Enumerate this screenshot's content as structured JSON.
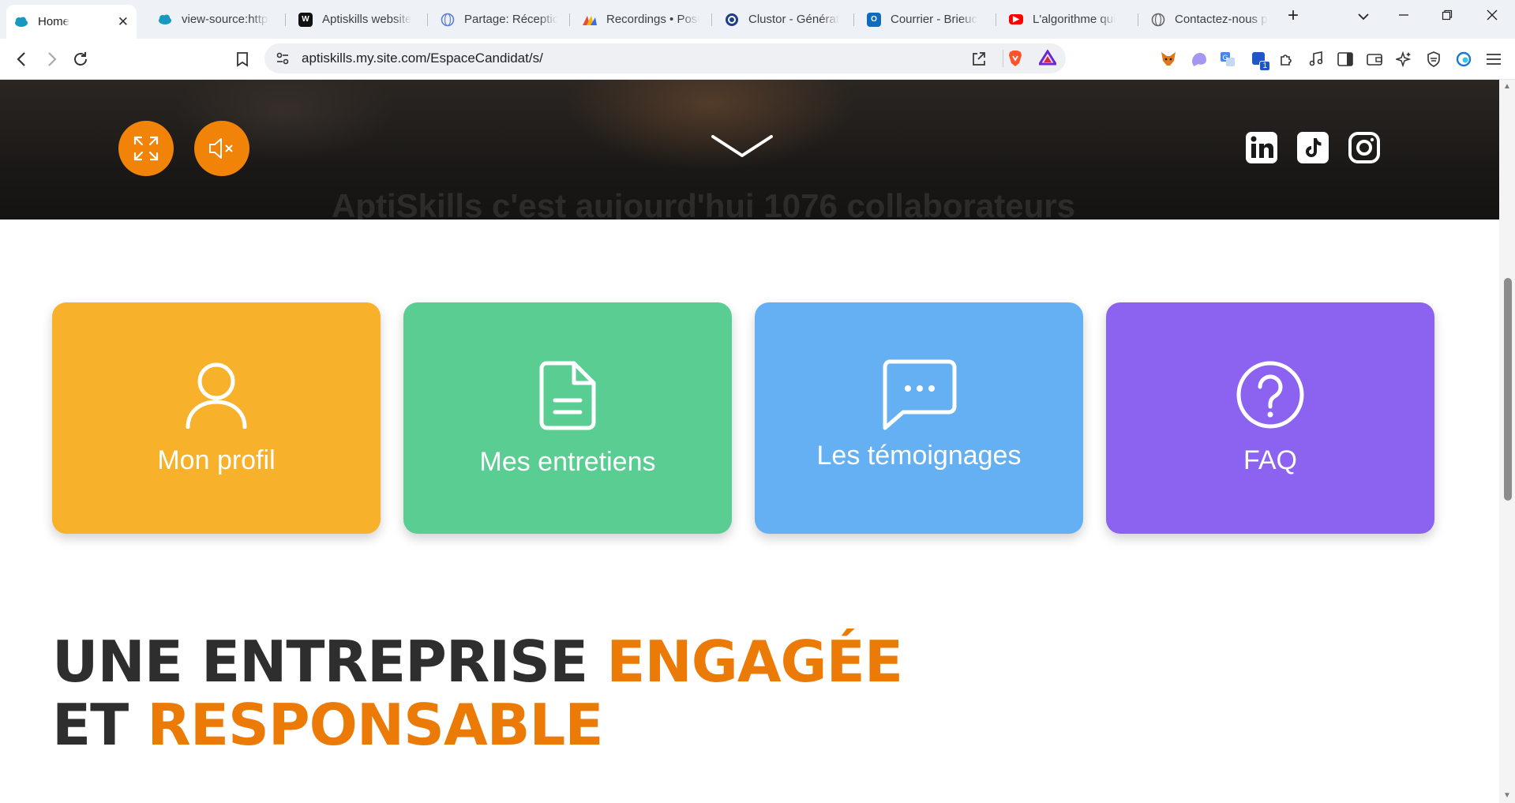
{
  "browser": {
    "tabs": [
      {
        "title": "Home",
        "active": true,
        "icon": "salesforce-cloud-icon"
      },
      {
        "title": "view-source:https",
        "icon": "salesforce-cloud-icon"
      },
      {
        "title": "Aptiskills website",
        "icon": "webflow-icon"
      },
      {
        "title": "Partage: Réception",
        "icon": "globe-icon"
      },
      {
        "title": "Recordings • Post",
        "icon": "recordings-icon"
      },
      {
        "title": "Clustor - Générat",
        "icon": "clustor-icon"
      },
      {
        "title": "Courrier - Brieuc",
        "icon": "outlook-icon"
      },
      {
        "title": "L'algorithme qui",
        "icon": "youtube-icon"
      },
      {
        "title": "Contactez-nous p",
        "icon": "globe-icon"
      }
    ],
    "new_tab": "+",
    "url": "aptiskills.my.site.com/EspaceCandidat/s/",
    "extension_badge": "1"
  },
  "hero": {
    "ghost_text": "AptiSkills c'est aujourd'hui 1076 collaborateurs"
  },
  "cards": [
    {
      "label": "Mon profil",
      "color": "#f8b12a",
      "icon": "user-icon"
    },
    {
      "label": "Mes entretiens",
      "color": "#5acd93",
      "icon": "document-icon"
    },
    {
      "label": "Les témoignages",
      "color": "#64b0f2",
      "icon": "chat-bubble-icon"
    },
    {
      "label": "FAQ",
      "color": "#8b63f0",
      "icon": "question-circle-icon"
    }
  ],
  "headline": {
    "line1_dark": "UNE ENTREPRISE",
    "line1_accent": "ENGAGÉE",
    "line2_dark": "ET",
    "line2_accent": "RESPONSABLE"
  },
  "colors": {
    "accent_orange": "#f08308",
    "headline_dark": "#2e2e2e"
  }
}
